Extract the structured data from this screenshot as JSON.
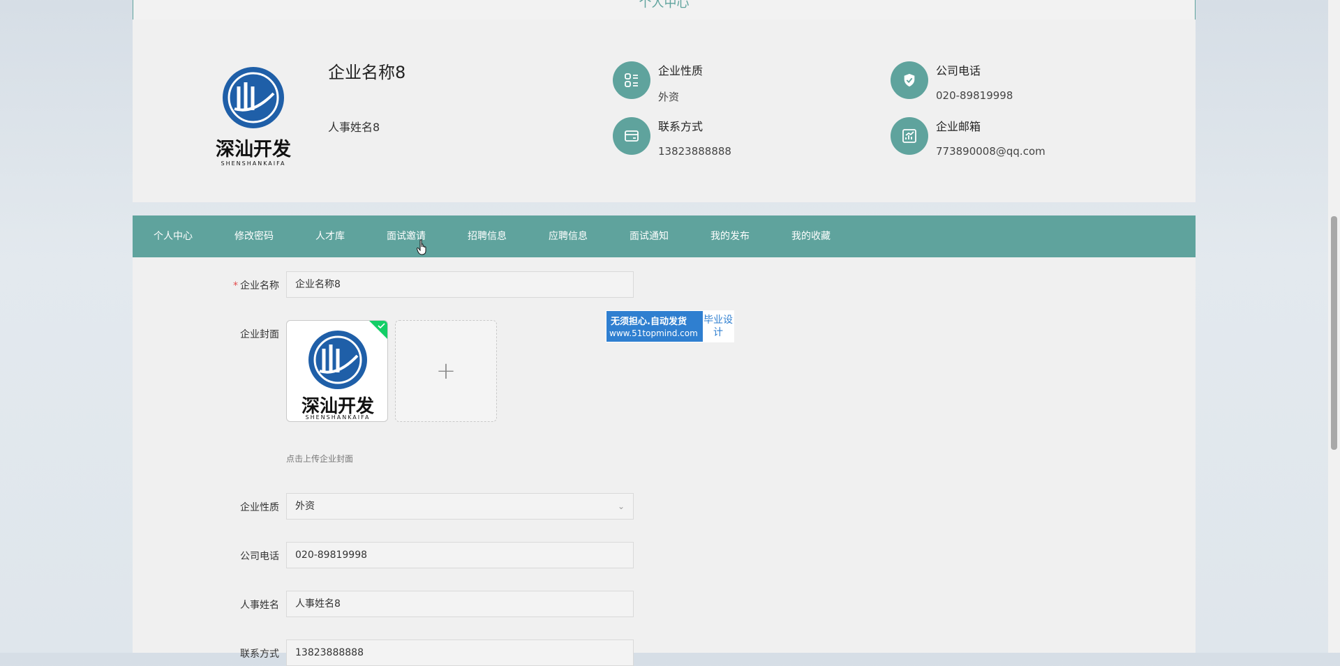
{
  "header": {
    "title": "个人中心"
  },
  "profile": {
    "company_name": "企业名称8",
    "hr_name": "人事姓名8",
    "logo_text": "深汕开发",
    "logo_subtext": "SHENSHANKAIFA",
    "info": [
      {
        "label": "企业性质",
        "value": "外资",
        "icon": "grid-icon"
      },
      {
        "label": "公司电话",
        "value": "020-89819998",
        "icon": "shield-icon"
      },
      {
        "label": "联系方式",
        "value": "13823888888",
        "icon": "card-icon"
      },
      {
        "label": "企业邮箱",
        "value": "773890008@qq.com",
        "icon": "chart-icon"
      }
    ]
  },
  "nav": {
    "items": [
      "个人中心",
      "修改密码",
      "人才库",
      "面试邀请",
      "招聘信息",
      "应聘信息",
      "面试通知",
      "我的发布",
      "我的收藏"
    ]
  },
  "form": {
    "company_name_label": "企业名称",
    "company_name_value": "企业名称8",
    "cover_label": "企业封面",
    "cover_tip": "点击上传企业封面",
    "nature_label": "企业性质",
    "nature_value": "外资",
    "phone_label": "公司电话",
    "phone_value": "020-89819998",
    "hr_label": "人事姓名",
    "hr_value": "人事姓名8",
    "contact_label": "联系方式",
    "contact_value": "13823888888"
  },
  "ad": {
    "line1": "无须担心.自动发货",
    "line2": "www.51topmind.com",
    "right": "毕业设计"
  },
  "colors": {
    "accent": "#5fa39d",
    "brand_blue": "#1f5fa8"
  }
}
